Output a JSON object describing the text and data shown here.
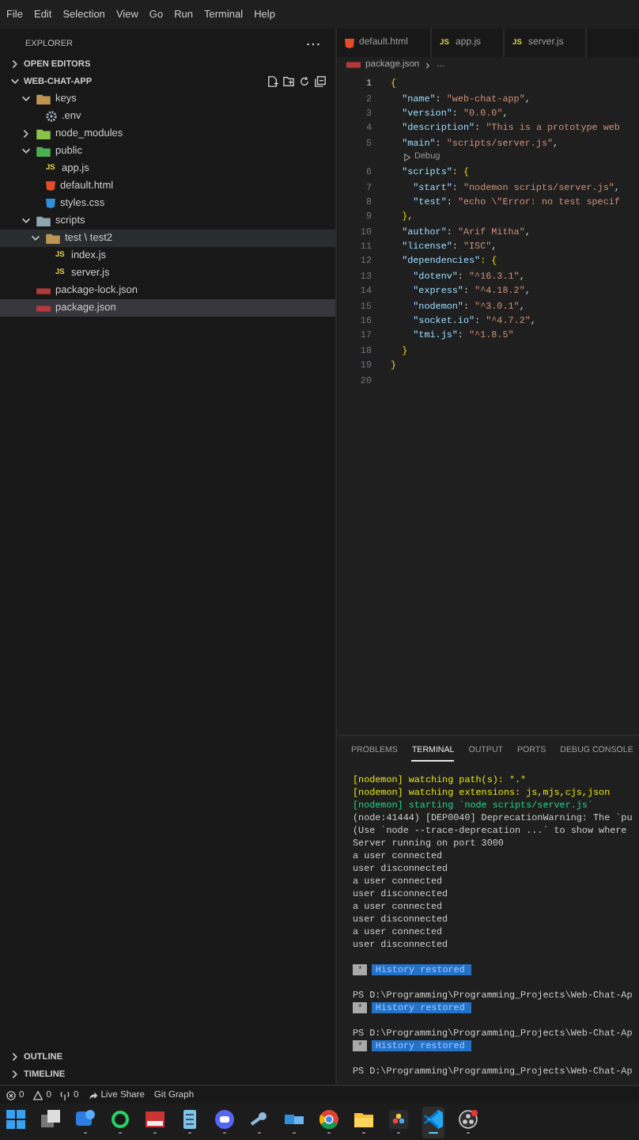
{
  "menu": [
    "File",
    "Edit",
    "Selection",
    "View",
    "Go",
    "Run",
    "Terminal",
    "Help"
  ],
  "sidebar": {
    "title": "EXPLORER",
    "sections": [
      {
        "label": "OPEN EDITORS",
        "expanded": false
      },
      {
        "label": "WEB-CHAT-APP",
        "expanded": true
      }
    ],
    "tree": [
      {
        "label": "keys",
        "kind": "folder",
        "color": "#c09553",
        "expanded": true,
        "selected": false,
        "hovered": false,
        "children": [
          {
            "label": ".env",
            "kind": "env",
            "selected": false,
            "hovered": false
          }
        ]
      },
      {
        "label": "node_modules",
        "kind": "folder",
        "color": "#8bc34a",
        "expanded": false,
        "selected": false,
        "hovered": false
      },
      {
        "label": "public",
        "kind": "folder",
        "color": "#4caf50",
        "expanded": true,
        "selected": false,
        "hovered": false,
        "children": [
          {
            "label": "app.js",
            "kind": "js",
            "icon_text": "JS",
            "selected": false,
            "hovered": false
          },
          {
            "label": "default.html",
            "kind": "html",
            "selected": false,
            "hovered": false
          },
          {
            "label": "styles.css",
            "kind": "css",
            "selected": false,
            "hovered": false
          }
        ]
      },
      {
        "label": "scripts",
        "kind": "folder",
        "color": "#90a4ae",
        "expanded": true,
        "selected": false,
        "hovered": false,
        "children": [
          {
            "label": "test \\ test2",
            "kind": "folder",
            "color": "#c09553",
            "expanded": true,
            "selected": false,
            "hovered": true,
            "children": [
              {
                "label": "index.js",
                "kind": "js",
                "icon_text": "JS",
                "selected": false,
                "hovered": false
              },
              {
                "label": "server.js",
                "kind": "js",
                "icon_text": "JS",
                "selected": false,
                "hovered": false
              }
            ]
          }
        ]
      },
      {
        "label": "package-lock.json",
        "kind": "json",
        "selected": false,
        "hovered": false
      },
      {
        "label": "package.json",
        "kind": "json",
        "selected": true,
        "hovered": false
      }
    ],
    "bottom_sections": [
      {
        "label": "OUTLINE",
        "expanded": false
      },
      {
        "label": "TIMELINE",
        "expanded": false
      }
    ]
  },
  "editor": {
    "tabs": [
      {
        "label": "default.html",
        "kind": "html",
        "selected": false
      },
      {
        "label": "app.js",
        "kind": "js",
        "icon_text": "JS",
        "selected": false
      },
      {
        "label": "server.js",
        "kind": "js",
        "icon_text": "JS",
        "selected": false
      }
    ],
    "breadcrumb": [
      "package.json",
      "..."
    ],
    "lines": [
      {
        "kind": "code",
        "number": "1",
        "text": "{",
        "current": true
      },
      {
        "kind": "code",
        "number": "2",
        "text": "  \"name\": \"web-chat-app\",",
        "current": false
      },
      {
        "kind": "code",
        "number": "3",
        "text": "  \"version\": \"0.0.0\",",
        "current": false
      },
      {
        "kind": "code",
        "number": "4",
        "text": "  \"description\": \"This is a prototype web",
        "current": false
      },
      {
        "kind": "code",
        "number": "5",
        "text": "  \"main\": \"scripts/server.js\",",
        "current": false
      },
      {
        "kind": "codelens",
        "text": "Debug"
      },
      {
        "kind": "code",
        "number": "6",
        "text": "  \"scripts\": {",
        "current": false
      },
      {
        "kind": "code",
        "number": "7",
        "text": "    \"start\": \"nodemon scripts/server.js\",",
        "current": false
      },
      {
        "kind": "code",
        "number": "8",
        "text": "    \"test\": \"echo \\\"Error: no test specif",
        "current": false
      },
      {
        "kind": "code",
        "number": "9",
        "text": "  },",
        "current": false
      },
      {
        "kind": "code",
        "number": "10",
        "text": "  \"author\": \"Arif Mitha\",",
        "current": false
      },
      {
        "kind": "code",
        "number": "11",
        "text": "  \"license\": \"ISC\",",
        "current": false
      },
      {
        "kind": "code",
        "number": "12",
        "text": "  \"dependencies\": {",
        "current": false
      },
      {
        "kind": "code",
        "number": "13",
        "text": "    \"dotenv\": \"^16.3.1\",",
        "current": false
      },
      {
        "kind": "code",
        "number": "14",
        "text": "    \"express\": \"^4.18.2\",",
        "current": false
      },
      {
        "kind": "code",
        "number": "15",
        "text": "    \"nodemon\": \"^3.0.1\",",
        "current": false
      },
      {
        "kind": "code",
        "number": "16",
        "text": "    \"socket.io\": \"^4.7.2\",",
        "current": false
      },
      {
        "kind": "code",
        "number": "17",
        "text": "    \"tmi.js\": \"^1.8.5\"",
        "current": false
      },
      {
        "kind": "code",
        "number": "18",
        "text": "  }",
        "current": false
      },
      {
        "kind": "code",
        "number": "19",
        "text": "}",
        "current": false
      },
      {
        "kind": "code",
        "number": "20",
        "current": false
      }
    ]
  },
  "panel": {
    "tabs": [
      {
        "label": "PROBLEMS",
        "selected": false
      },
      {
        "label": "TERMINAL",
        "selected": true
      },
      {
        "label": "OUTPUT",
        "selected": false
      },
      {
        "label": "PORTS",
        "selected": false
      },
      {
        "label": "DEBUG CONSOLE",
        "selected": false
      }
    ],
    "terminal": [
      {
        "kind": "watch",
        "text": "[nodemon] watching path(s): *.*"
      },
      {
        "kind": "watch",
        "text": "[nodemon] watching extensions: js,mjs,cjs,json"
      },
      {
        "kind": "start",
        "text": "[nodemon] starting `node scripts/server.js`"
      },
      {
        "kind": "output",
        "text": "(node:41444) [DEP0040] DeprecationWarning: The `pu"
      },
      {
        "kind": "output",
        "text": "(Use `node --trace-deprecation ...` to show where"
      },
      {
        "kind": "output",
        "text": "Server running on port 3000"
      },
      {
        "kind": "output",
        "text": "a user connected"
      },
      {
        "kind": "output",
        "text": "user disconnected"
      },
      {
        "kind": "output",
        "text": "a user connected"
      },
      {
        "kind": "output",
        "text": "user disconnected"
      },
      {
        "kind": "output",
        "text": "a user connected"
      },
      {
        "kind": "output",
        "text": "user disconnected"
      },
      {
        "kind": "output",
        "text": "a user connected"
      },
      {
        "kind": "output",
        "text": "user disconnected"
      },
      {
        "kind": "gap"
      },
      {
        "kind": "history",
        "marker": "*",
        "text": "History restored"
      },
      {
        "kind": "gap"
      },
      {
        "kind": "output",
        "text": "PS D:\\Programming\\Programming_Projects\\Web-Chat-Ap"
      },
      {
        "kind": "history",
        "marker": "*",
        "text": "History restored"
      },
      {
        "kind": "gap"
      },
      {
        "kind": "output",
        "text": "PS D:\\Programming\\Programming_Projects\\Web-Chat-Ap"
      },
      {
        "kind": "history",
        "marker": "*",
        "text": "History restored"
      },
      {
        "kind": "gap"
      },
      {
        "kind": "output",
        "text": "PS D:\\Programming\\Programming_Projects\\Web-Chat-Ap"
      }
    ]
  },
  "status_bar": [
    {
      "kind": "errors",
      "text": "0"
    },
    {
      "kind": "warnings",
      "text": "0"
    },
    {
      "kind": "ports",
      "text": "0"
    },
    {
      "kind": "liveshare",
      "text": "Live Share"
    },
    {
      "kind": "plain",
      "text": "Git Graph"
    }
  ],
  "taskbar": [
    {
      "kind": "start",
      "running": false,
      "active": false
    },
    {
      "kind": "taskview",
      "running": false,
      "active": false
    },
    {
      "kind": "chat",
      "running": true,
      "active": false
    },
    {
      "kind": "phone",
      "running": true,
      "active": false
    },
    {
      "kind": "mixer",
      "running": true,
      "active": false
    },
    {
      "kind": "notepad",
      "running": true,
      "active": false
    },
    {
      "kind": "gamepad",
      "running": true,
      "active": false
    },
    {
      "kind": "steam",
      "running": true,
      "active": false
    },
    {
      "kind": "window",
      "running": true,
      "active": false
    },
    {
      "kind": "browser",
      "running": true,
      "active": false
    },
    {
      "kind": "folder",
      "running": true,
      "active": false
    },
    {
      "kind": "editor",
      "running": true,
      "active": false
    },
    {
      "kind": "code",
      "running": true,
      "active": true
    },
    {
      "kind": "record",
      "running": true,
      "active": false
    }
  ]
}
